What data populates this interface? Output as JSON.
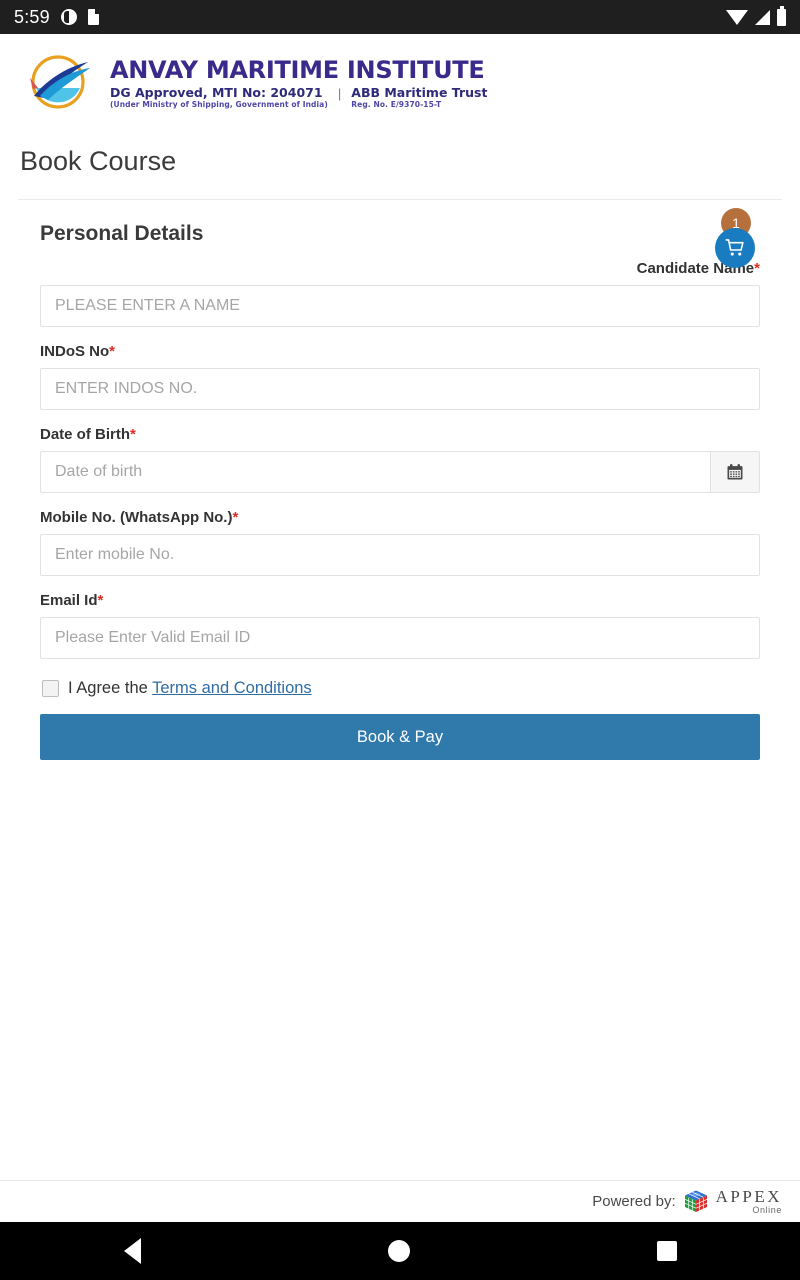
{
  "statusbar": {
    "time": "5:59",
    "left_icons": [
      "clock-icon",
      "sd-card-icon"
    ],
    "right_icons": [
      "wifi-icon",
      "signal-icon",
      "battery-icon"
    ]
  },
  "brand": {
    "logo_name": "anvay-maritime-logo",
    "title": "ANVAY MARITIME INSTITUTE",
    "approval": "DG Approved, MTI No: 204071",
    "approval_fine": "(Under Ministry of Shipping, Government of India)",
    "divider": "|",
    "trust": "ABB Maritime Trust",
    "trust_fine": "Reg. No. E/9370-15-T"
  },
  "page": {
    "title": "Book Course"
  },
  "section": {
    "title": "Personal Details",
    "cart_count": "1",
    "cart_icon": "shopping-cart-icon",
    "cart_badge_color": "#b5703c",
    "cart_circle_color": "#1a7cc0"
  },
  "fields": {
    "candidate_name": {
      "label": "Candidate Name",
      "required_mark": "*",
      "placeholder": "PLEASE ENTER A NAME",
      "value": ""
    },
    "indos_no": {
      "label": "INDoS No",
      "required_mark": "*",
      "placeholder": "ENTER INDOS NO.",
      "value": ""
    },
    "date_of_birth": {
      "label": "Date of Birth",
      "required_mark": "*",
      "placeholder": "Date of birth",
      "value": "",
      "calendar_icon": "calendar-icon"
    },
    "mobile_no": {
      "label": "Mobile No. (WhatsApp No.)",
      "required_mark": "*",
      "placeholder": "Enter mobile No.",
      "value": ""
    },
    "email_id": {
      "label": "Email Id",
      "required_mark": "*",
      "placeholder": "Please Enter Valid Email ID",
      "value": ""
    }
  },
  "agreement": {
    "checked": false,
    "text": "I Agree the ",
    "link_text": "Terms and Conditions",
    "link_color": "#2e6da4"
  },
  "submit": {
    "label": "Book & Pay",
    "color": "#3079ab"
  },
  "footer": {
    "powered_by": "Powered by:",
    "logo_name": "appex-cube-logo",
    "brand": "APPEX",
    "brand_sub": "Online"
  },
  "navbar": {
    "back": "back-button",
    "home": "home-button",
    "recents": "recents-button"
  }
}
